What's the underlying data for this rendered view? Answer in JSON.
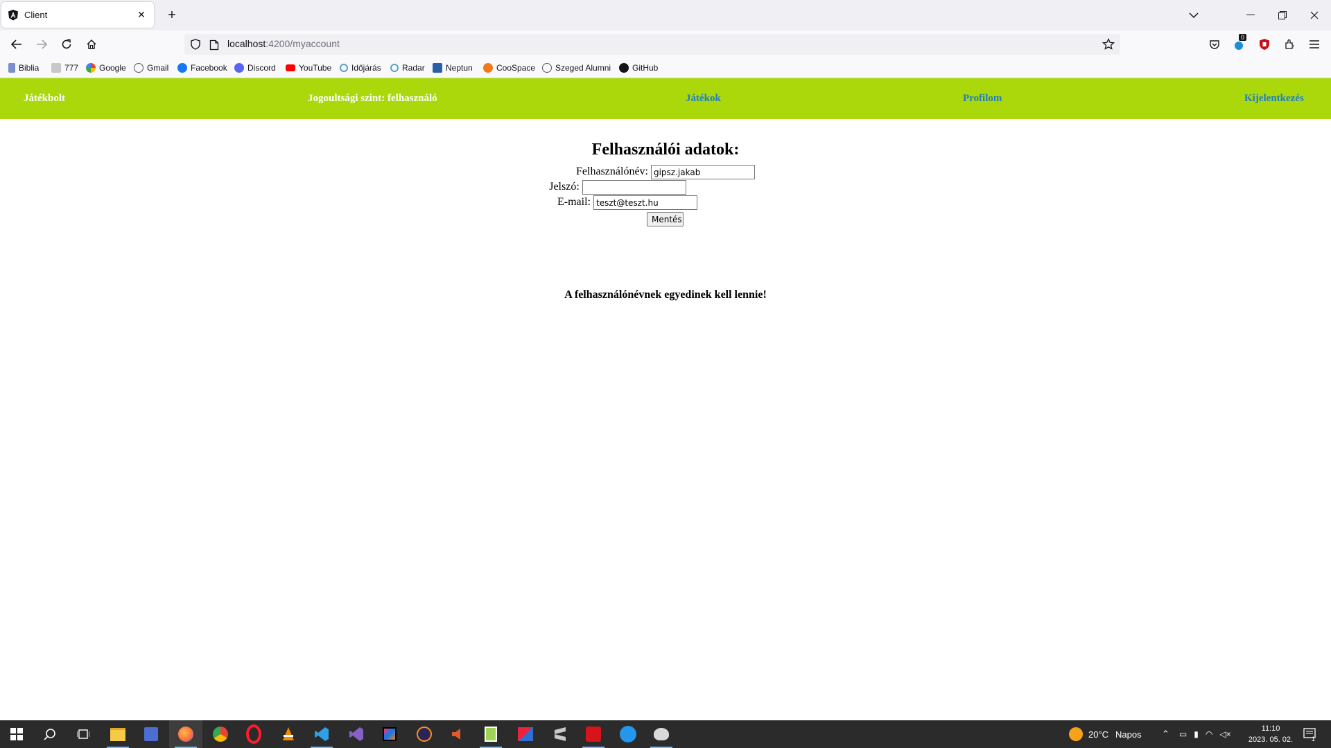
{
  "browser": {
    "tab_title": "Client",
    "url_host": "localhost",
    "url_path": ":4200/myaccount",
    "pocket_badge": "0",
    "bookmarks": [
      "Biblia",
      "777",
      "Google",
      "Gmail",
      "Facebook",
      "Discord",
      "YouTube",
      "Időjárás",
      "Radar",
      "Neptun",
      "CooSpace",
      "Szeged Alumni",
      "GitHub"
    ]
  },
  "header": {
    "brand": "Játékbolt",
    "role": "Jogoultsági szint: felhasználó",
    "games": "Játékok",
    "profile": "Profilom",
    "logout": "Kijelentkezés"
  },
  "form": {
    "title": "Felhasználói adatok:",
    "username_label": "Felhasználónév:",
    "username_value": "gipsz.jakab",
    "password_label": "Jelszó:",
    "password_value": "",
    "email_label": "E-mail:",
    "email_value": "teszt@teszt.hu",
    "save_label": "Mentés"
  },
  "message": "A felhasználónévnek egyedinek kell lennie!",
  "taskbar": {
    "weather_temp": "20°C",
    "weather_text": "Napos",
    "time": "11:10",
    "date": "2023. 05. 02.",
    "notification_count": "1"
  },
  "colors": {
    "header_bg": "#abd80b",
    "header_link": "#1f7ec2",
    "taskbar_bg": "#2b2b2b"
  }
}
